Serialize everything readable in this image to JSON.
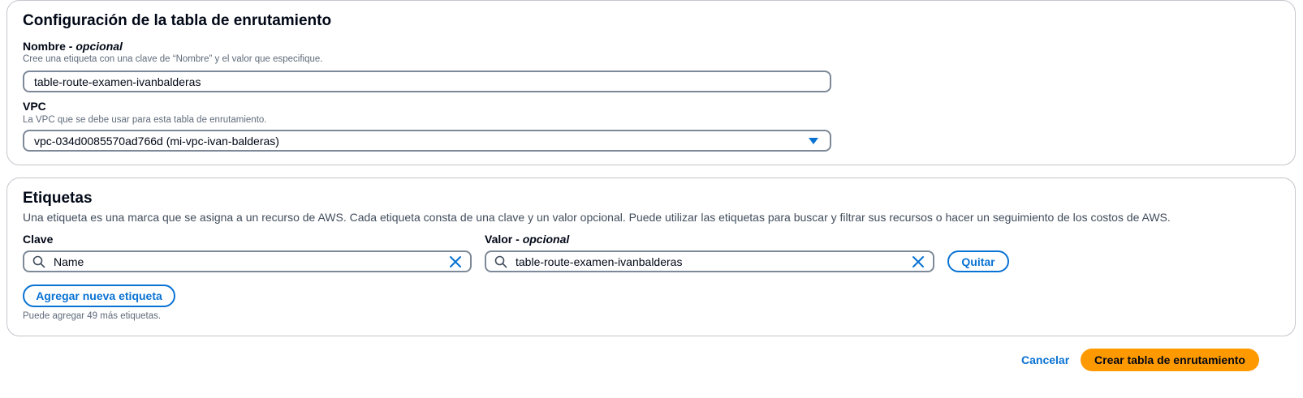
{
  "route_table_config": {
    "title": "Configuración de la tabla de enrutamiento",
    "name_field": {
      "label": "Nombre",
      "label_suffix": "opcional",
      "description": "Cree una etiqueta con una clave de “Nombre” y el valor que especifique.",
      "value": "table-route-examen-ivanbalderas"
    },
    "vpc_field": {
      "label": "VPC",
      "description": "La VPC que se debe usar para esta tabla de enrutamiento.",
      "selected": "vpc-034d0085570ad766d (mi-vpc-ivan-balderas)"
    }
  },
  "tags": {
    "title": "Etiquetas",
    "description": "Una etiqueta es una marca que se asigna a un recurso de AWS. Cada etiqueta consta de una clave y un valor opcional. Puede utilizar las etiquetas para buscar y filtrar sus recursos o hacer un seguimiento de los costos de AWS.",
    "key_label": "Clave",
    "value_label": "Valor",
    "value_label_suffix": "opcional",
    "rows": [
      {
        "key": "Name",
        "value": "table-route-examen-ivanbalderas"
      }
    ],
    "remove_label": "Quitar",
    "add_label": "Agregar nueva etiqueta",
    "remaining_text": "Puede agregar 49 más etiquetas."
  },
  "footer": {
    "cancel_label": "Cancelar",
    "create_label": "Crear tabla de enrutamiento"
  },
  "colors": {
    "accent": "#0972d3",
    "primary_button": "#ff9900",
    "border": "#c6c6cd",
    "input_border": "#7d8998"
  },
  "icons": {
    "search": "search-icon",
    "clear": "close-icon",
    "dropdown": "caret-down-icon"
  }
}
